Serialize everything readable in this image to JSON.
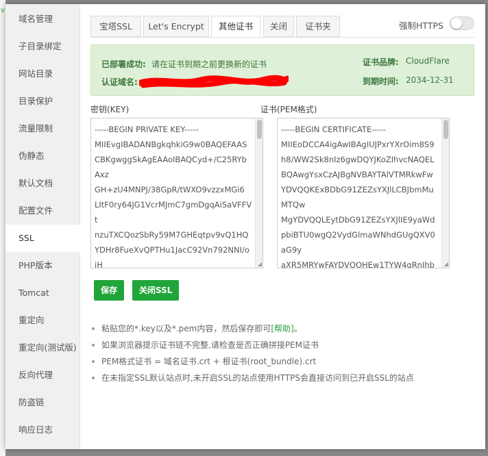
{
  "sidebar": {
    "items": [
      {
        "label": "域名管理",
        "active": false
      },
      {
        "label": "子目录绑定",
        "active": false
      },
      {
        "label": "网站目录",
        "active": false
      },
      {
        "label": "目录保护",
        "active": false
      },
      {
        "label": "流量限制",
        "active": false
      },
      {
        "label": "伪静态",
        "active": false
      },
      {
        "label": "默认文档",
        "active": false
      },
      {
        "label": "配置文件",
        "active": false
      },
      {
        "label": "SSL",
        "active": true
      },
      {
        "label": "PHP版本",
        "active": false
      },
      {
        "label": "Tomcat",
        "active": false
      },
      {
        "label": "重定向",
        "active": false
      },
      {
        "label": "重定向(测试版)",
        "active": false
      },
      {
        "label": "反向代理",
        "active": false
      },
      {
        "label": "防盗链",
        "active": false
      },
      {
        "label": "响应日志",
        "active": false
      }
    ]
  },
  "tabs": [
    {
      "label": "宝塔SSL",
      "active": false
    },
    {
      "label": "Let's Encrypt",
      "active": false
    },
    {
      "label": "其他证书",
      "active": true
    },
    {
      "label": "关闭",
      "active": false
    },
    {
      "label": "证书夹",
      "active": false
    }
  ],
  "force_https": {
    "label": "强制HTTPS",
    "enabled": false
  },
  "status": {
    "deployed_label": "已部署成功:",
    "deployed_text": "请在证书到期之前更换新的证书",
    "domain_label": "认证域名:",
    "brand_label": "证书品牌:",
    "brand_value": "CloudFlare",
    "expiry_label": "到期时间:",
    "expiry_value": "2034-12-31"
  },
  "key": {
    "label": "密钥(KEY)",
    "lines": [
      "-----BEGIN PRIVATE KEY-----",
      "MIIEvgIBADANBgkqhkiG9w0BAQEFAAS",
      "CBKgwggSkAgEAAoIBAQCyd+/C25RYb",
      "Axz",
      "GH+zU4MNPJ/38GpR/tWXO9vzzxMGi6",
      "LItF0ry64JG1VcrMJmC7gmDgqAiSaVFFV",
      "t",
      "nzuTXCQozSbRy59M7GHEqtpv9vQ1HQ",
      "YDHr8FueXvQPTHu1JacC92Vn792NNI/o",
      "iH"
    ]
  },
  "cert": {
    "label": "证书(PEM格式)",
    "lines": [
      "-----BEGIN CERTIFICATE-----",
      "MIIEoDCCA4igAwIBAgIUJPxrYXrOim8S9",
      "h8/WW2Sk8nIz6gwDQYJKoZIhvcNAQEL",
      "BQAwgYsxCzAJBgNVBAYTAlVTMRkwFw",
      "YDVQQKExBDbG91ZEZsYXJlLCBJbmMu",
      "MTQw",
      "MgYDVQQLEytDbG91ZEZsYXJlIE9yaWd",
      "pbiBTU0wgQ2VydGlmaWNhdGUgQXV0",
      "aG9y",
      "aXR5MRYwFAYDVQQHEw1TYW4gRnJhb"
    ]
  },
  "buttons": {
    "save": "保存",
    "close_ssl": "关闭SSL"
  },
  "tips": {
    "t1_prefix": "粘贴您的*.key以及*.pem内容，然后保存即可",
    "t1_link": "[帮助]",
    "t1_suffix": "。",
    "t2": "如果浏览器提示证书链不完整,请检查是否正确拼接PEM证书",
    "t3": "PEM格式证书 = 域名证书.crt + 根证书(root_bundle).crt",
    "t4": "在未指定SSL默认站点时,未开启SSL的站点使用HTTPS会直接访问到已开启SSL的站点"
  },
  "colors": {
    "accent": "#20a53a",
    "success_bg": "#dff0d8",
    "success_text": "#3c763d",
    "redaction": "#ff0000"
  }
}
